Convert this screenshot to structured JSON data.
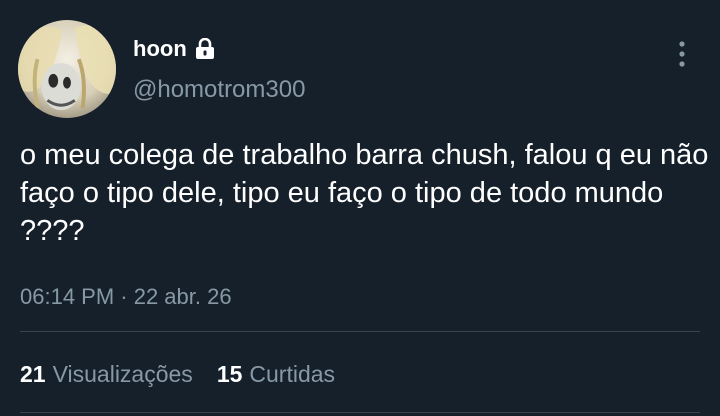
{
  "author": {
    "display_name": "hoon",
    "handle": "@homotrom300",
    "protected_icon": "lock-icon",
    "avatar": "profile-photo"
  },
  "menu_icon": "more-vertical-icon",
  "tweet": {
    "text": "o meu colega de trabalho barra chush, falou q eu não faço o tipo dele, tipo eu faço o tipo de todo mundo ????",
    "timestamp": "06:14 PM · 22 abr. 26"
  },
  "stats": {
    "views_count": "21",
    "views_label": "Visualizações",
    "likes_count": "15",
    "likes_label": "Curtidas"
  },
  "colors": {
    "background": "#15202b",
    "text_primary": "#ffffff",
    "text_secondary": "#8899a6",
    "divider": "#38444d"
  }
}
